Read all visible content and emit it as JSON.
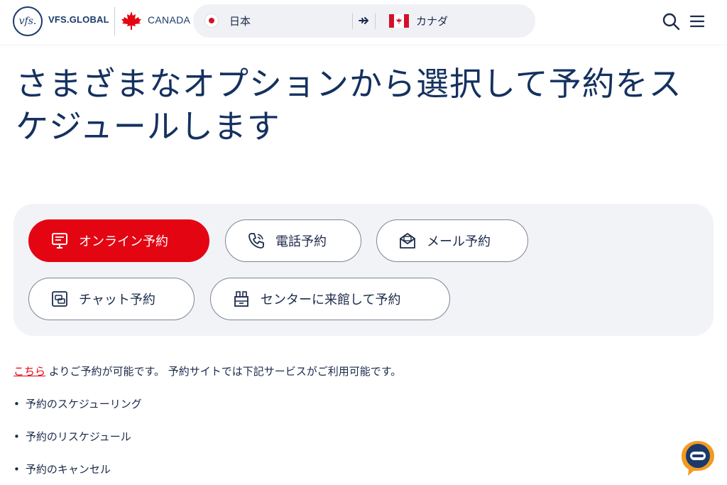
{
  "header": {
    "logo_mark": "vfs.",
    "logo_text": "VFS.GLOBAL",
    "country": "CANADA",
    "route": {
      "from": "日本",
      "to": "カナダ"
    },
    "icons": [
      "search-icon",
      "menu-icon",
      "maple-leaf-icon",
      "plane-icon"
    ]
  },
  "title": "さまざまなオプションから選択して予約をスケジュールします",
  "options": [
    {
      "label": "オンライン予約",
      "icon": "monitor-icon",
      "active": true
    },
    {
      "label": "電話予約",
      "icon": "phone-icon",
      "active": false
    },
    {
      "label": "メール予約",
      "icon": "envelope-icon",
      "active": false
    },
    {
      "label": "チャット予約",
      "icon": "chat-icon",
      "active": false
    },
    {
      "label": "センターに来館して予約",
      "icon": "building-icon",
      "active": false
    }
  ],
  "intro": {
    "link_text": "こちら",
    "text": " よりご予約が可能です。 予約サイトでは下記サービスがご利用可能です。"
  },
  "services": [
    "予約のスケジューリング",
    "予約のリスケジュール",
    "予約のキャンセル"
  ],
  "colors": {
    "accent": "#e40513",
    "navy": "#14315f",
    "panel": "#f2f3f7"
  }
}
